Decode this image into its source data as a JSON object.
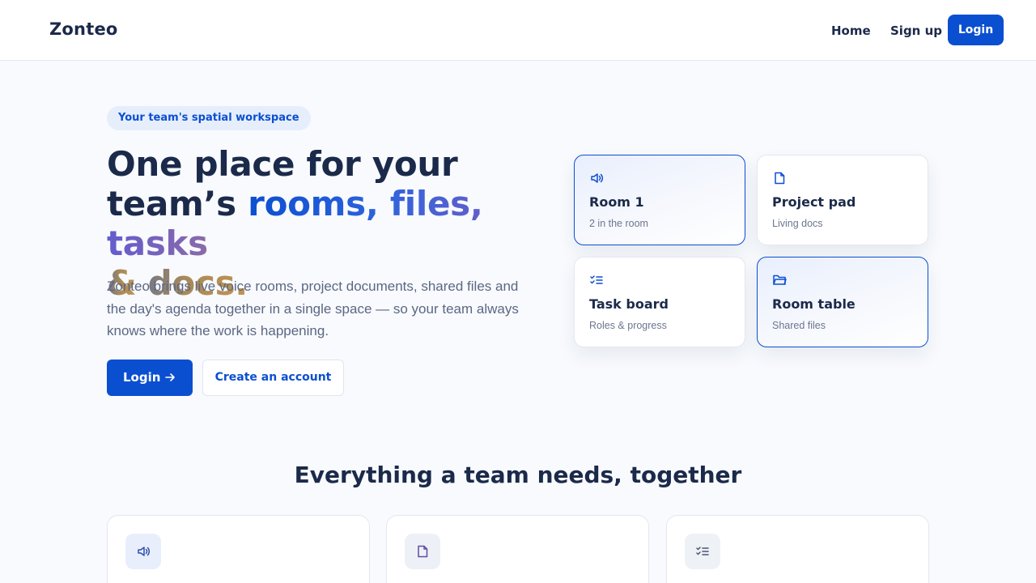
{
  "header": {
    "brand": "Zonteo",
    "nav": {
      "home": "Home",
      "signup": "Sign up",
      "login": "Login"
    }
  },
  "hero": {
    "pill": "Your team's spatial workspace",
    "headline": {
      "line1": "One place for your",
      "line2_plain": "team’s ",
      "line2_grad": "rooms, files, tasks",
      "line3_grad_a": "&",
      "line3_grad_b": " docs."
    },
    "description": "Zonteo brings live voice rooms, project documents, shared files and the day's agenda together in a single space — so your team always knows where the work is happening.",
    "primary_button": "Login",
    "secondary_button": "Create an account"
  },
  "tiles": [
    {
      "title": "Room 1",
      "subtitle": "2 in the room",
      "icon": "speaker-icon",
      "active": true
    },
    {
      "title": "Project pad",
      "subtitle": "Living docs",
      "icon": "document-icon",
      "active": false
    },
    {
      "title": "Task board",
      "subtitle": "Roles & progress",
      "icon": "checklist-icon",
      "active": false
    },
    {
      "title": "Room table",
      "subtitle": "Shared files",
      "icon": "folder-icon",
      "active": true
    }
  ],
  "features": {
    "title": "Everything a team needs, together",
    "cards": [
      {
        "icon": "speaker-icon"
      },
      {
        "icon": "document-icon"
      },
      {
        "icon": "checklist-icon"
      }
    ]
  },
  "colors": {
    "accent": "#0b4fd1",
    "text": "#1b2a4a",
    "muted": "#5b6784",
    "background": "#f8fafd"
  }
}
